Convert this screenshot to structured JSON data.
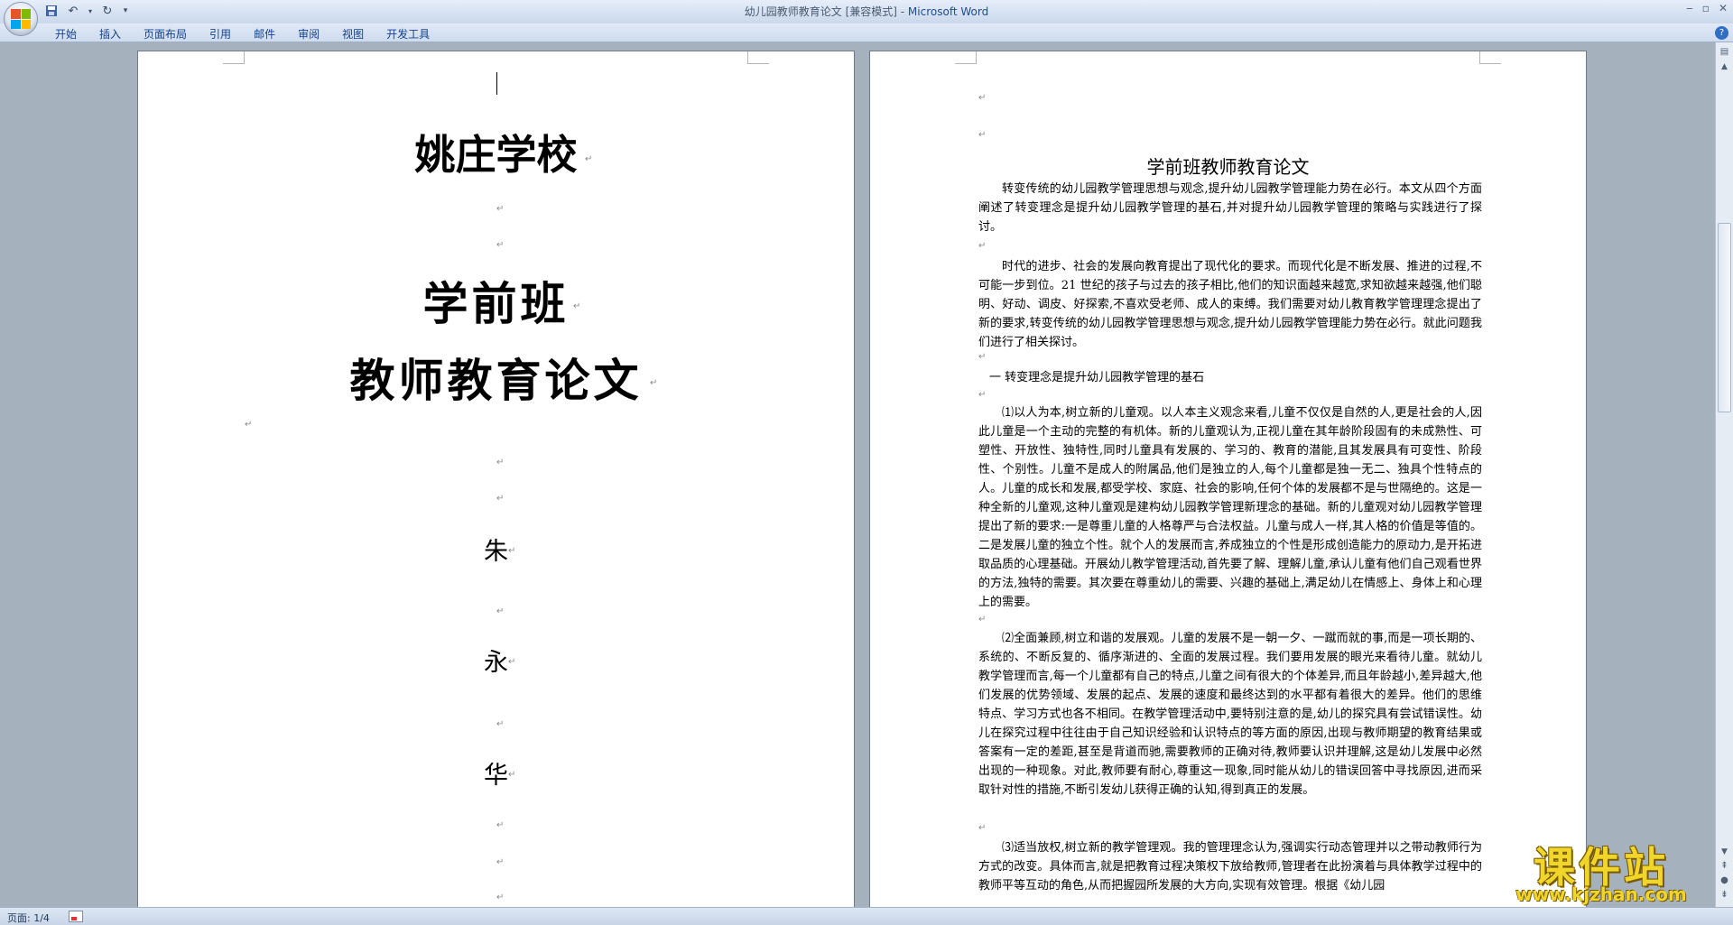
{
  "window": {
    "title_doc": "幼儿园教师教育论文 [兼容模式] - ",
    "title_app": "Microsoft Word"
  },
  "ribbon": {
    "tabs": [
      "开始",
      "插入",
      "页面布局",
      "引用",
      "邮件",
      "审阅",
      "视图",
      "开发工具"
    ],
    "help": "?"
  },
  "page1": {
    "school": "姚庄学校",
    "class_name": "学前班",
    "title": "教师教育论文",
    "author_chars": [
      "朱",
      "永",
      "华"
    ]
  },
  "page2": {
    "title": "学前班教师教育论文",
    "abstract": "转变传统的幼儿园教学管理思想与观念,提升幼儿园教学管理能力势在必行。本文从四个方面阐述了转变理念是提升幼儿园教学管理的基石,并对提升幼儿园教学管理的策略与实践进行了探讨。",
    "intro": "时代的进步、社会的发展向教育提出了现代化的要求。而现代化是不断发展、推进的过程,不可能一步到位。21 世纪的孩子与过去的孩子相比,他们的知识面越来越宽,求知欲越来越强,他们聪明、好动、调皮、好探索,不喜欢受老师、成人的束缚。我们需要对幼儿教育教学管理理念提出了新的要求,转变传统的幼儿园教学管理思想与观念,提升幼儿园教学管理能力势在必行。就此问题我们进行了相关探讨。",
    "section_heading": "一 转变理念是提升幼儿园教学管理的基石",
    "para1": "⑴以人为本,树立新的儿童观。以人本主义观念来看,儿童不仅仅是自然的人,更是社会的人,因此儿童是一个主动的完整的有机体。新的儿童观认为,正视儿童在其年龄阶段固有的未成熟性、可塑性、开放性、独特性,同时儿童具有发展的、学习的、教育的潜能,且其发展具有可变性、阶段性、个别性。儿童不是成人的附属品,他们是独立的人,每个儿童都是独一无二、独具个性特点的人。儿童的成长和发展,都受学校、家庭、社会的影响,任何个体的发展都不是与世隔绝的。这是一种全新的儿童观,这种儿童观是建构幼儿园教学管理新理念的基础。新的儿童观对幼儿园教学管理提出了新的要求:一是尊重儿童的人格尊严与合法权益。儿童与成人一样,其人格的价值是等值的。二是发展儿童的独立个性。就个人的发展而言,养成独立的个性是形成创造能力的原动力,是开拓进取品质的心理基础。开展幼儿教学管理活动,首先要了解、理解儿童,承认儿童有他们自己观看世界的方法,独特的需要。其次要在尊重幼儿的需要、兴趣的基础上,满足幼儿在情感上、身体上和心理上的需要。",
    "para2": "⑵全面兼顾,树立和谐的发展观。儿童的发展不是一朝一夕、一蹴而就的事,而是一项长期的、系统的、不断反复的、循序渐进的、全面的发展过程。我们要用发展的眼光来看待儿童。就幼儿教学管理而言,每一个儿童都有自己的特点,儿童之间有很大的个体差异,而且年龄越小,差异越大,他们发展的优势领域、发展的起点、发展的速度和最终达到的水平都有着很大的差异。他们的思维特点、学习方式也各不相同。在教学管理活动中,要特别注意的是,幼儿的探究具有尝试错误性。幼儿在探究过程中往往由于自己知识经验和认识特点的等方面的原因,出现与教师期望的教育结果或答案有一定的差距,甚至是背道而驰,需要教师的正确对待,教师要认识并理解,这是幼儿发展中必然出现的一种现象。对此,教师要有耐心,尊重这一现象,同时能从幼儿的错误回答中寻找原因,进而采取针对性的措施,不断引发幼儿获得正确的认知,得到真正的发展。",
    "para3": "⑶适当放权,树立新的教学管理观。我的管理理念认为,强调实行动态管理并以之带动教师行为方式的改变。具体而言,就是把教育过程决策权下放给教师,管理者在此扮演着与具体教学过程中的教师平等互动的角色,从而把握园所发展的大方向,实现有效管理。根据《幼儿园"
  },
  "status": {
    "page": "页面: 1/4"
  },
  "watermark": {
    "cn": "课件站",
    "en": "www.kjzhan.com"
  }
}
